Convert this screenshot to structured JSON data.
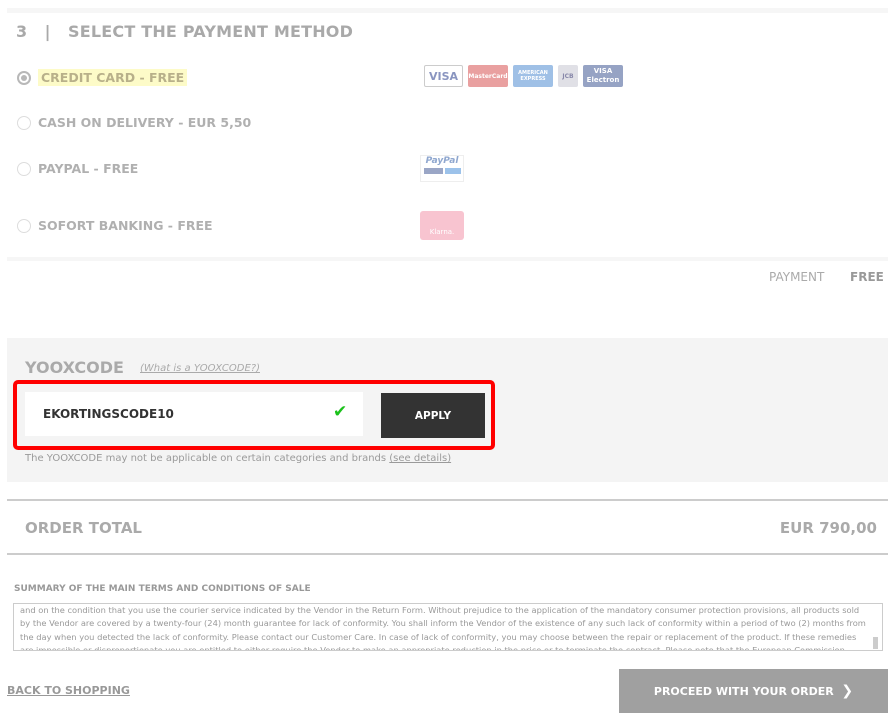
{
  "section": {
    "step": "3",
    "separator": "|",
    "title": "SELECT THE PAYMENT METHOD"
  },
  "payment_options": [
    {
      "label": "CREDIT CARD - FREE",
      "selected": true
    },
    {
      "label": "CASH ON DELIVERY - EUR 5,50",
      "selected": false
    },
    {
      "label": "PAYPAL - FREE",
      "selected": false
    },
    {
      "label": "SOFORT BANKING - FREE",
      "selected": false
    }
  ],
  "cards": [
    "VISA",
    "MasterCard",
    "AMERICAN EXPRESS",
    "JCB",
    "VISA Electron"
  ],
  "paypal_logo": "PayPal",
  "klarna_logo": "Klarna.",
  "payment_summary": {
    "label": "PAYMENT",
    "value": "FREE"
  },
  "yooxcode": {
    "title": "YOOXCODE",
    "help_link": "(What is a YOOXCODE?)",
    "value": "EKORTINGSCODE10",
    "apply": "APPLY",
    "note": "The YOOXCODE may not be applicable on certain categories and brands",
    "note_link": "(see details)"
  },
  "order_total": {
    "label": "ORDER TOTAL",
    "value": "EUR 790,00"
  },
  "terms": {
    "title": "SUMMARY OF THE MAIN TERMS AND CONDITIONS OF SALE",
    "text": "and on the condition that you use the courier service indicated by the Vendor in the Return Form. Without prejudice to the application of the mandatory consumer protection provisions, all products sold by the Vendor are covered by a twenty-four (24) month guarantee for lack of conformity. You shall inform the Vendor of the existence of any such lack of conformity within a period of two (2) months from the day when you detected the lack of conformity. Please contact our Customer Care. In case of lack of conformity, you may choose between the repair or replacement of the product. If these remedies are impossible or disproportionate you are entitled to either require the Vendor to make an appropriate reduction in the price or to terminate the contract. Please note that the European Commission provides a"
  },
  "actions": {
    "back": "BACK TO SHOPPING",
    "proceed": "PROCEED WITH YOUR ORDER",
    "proceed_icon": "chevron-right-icon"
  },
  "colors": {
    "highlight": "#fdfbc8",
    "apply_bg": "#333333",
    "check": "#1bc21b",
    "annotation": "#ff0000",
    "proceed_bg": "#a0a0a0"
  }
}
